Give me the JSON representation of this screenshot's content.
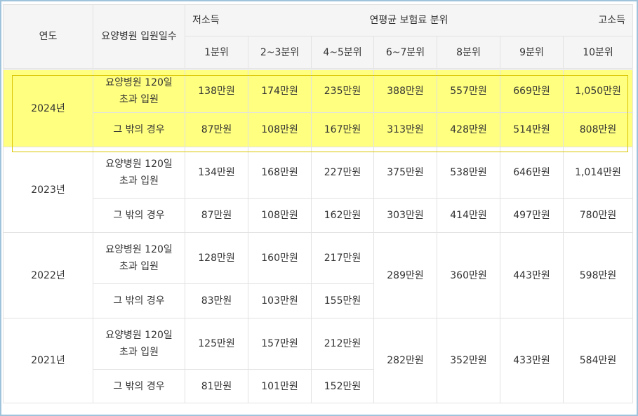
{
  "header": {
    "year_label": "연도",
    "days_label": "요양병원 입원일수",
    "group_low": "저소득",
    "group_title": "연평균 보험료 분위",
    "group_high": "고소득",
    "deciles": [
      "1분위",
      "2~3분위",
      "4~5분위",
      "6~7분위",
      "8분위",
      "9분위",
      "10분위"
    ]
  },
  "rows_2024": {
    "year": "2024년",
    "over_label": "요양병원 120일\n초과 입원",
    "other_label": "그 밖의 경우",
    "over": [
      "138만원",
      "174만원",
      "235만원",
      "388만원",
      "557만원",
      "669만원",
      "1,050만원"
    ],
    "other": [
      "87만원",
      "108만원",
      "167만원",
      "313만원",
      "428만원",
      "514만원",
      "808만원"
    ]
  },
  "rows_2023": {
    "year": "2023년",
    "over_label": "요양병원 120일\n초과 입원",
    "other_label": "그 밖의 경우",
    "over": [
      "134만원",
      "168만원",
      "227만원",
      "375만원",
      "538만원",
      "646만원",
      "1,014만원"
    ],
    "other": [
      "87만원",
      "108만원",
      "162만원",
      "303만원",
      "414만원",
      "497만원",
      "780만원"
    ]
  },
  "rows_2022": {
    "year": "2022년",
    "over_label": "요양병원 120일\n초과 입원",
    "other_label": "그 밖의 경우",
    "over": [
      "128만원",
      "160만원",
      "217만원"
    ],
    "other": [
      "83만원",
      "103만원",
      "155만원"
    ],
    "merged": [
      "289만원",
      "360만원",
      "443만원",
      "598만원"
    ]
  },
  "rows_2021": {
    "year": "2021년",
    "over_label": "요양병원 120일\n초과 입원",
    "other_label": "그 밖의 경우",
    "over": [
      "125만원",
      "157만원",
      "212만원"
    ],
    "other": [
      "81만원",
      "101만원",
      "152만원"
    ],
    "merged": [
      "282만원",
      "352만원",
      "433만원",
      "584만원"
    ]
  },
  "colors": {
    "highlight": "#ffff80",
    "border": "#e2e2e2",
    "header_bg": "#f5f5f5",
    "frame": "#9ec3db"
  }
}
